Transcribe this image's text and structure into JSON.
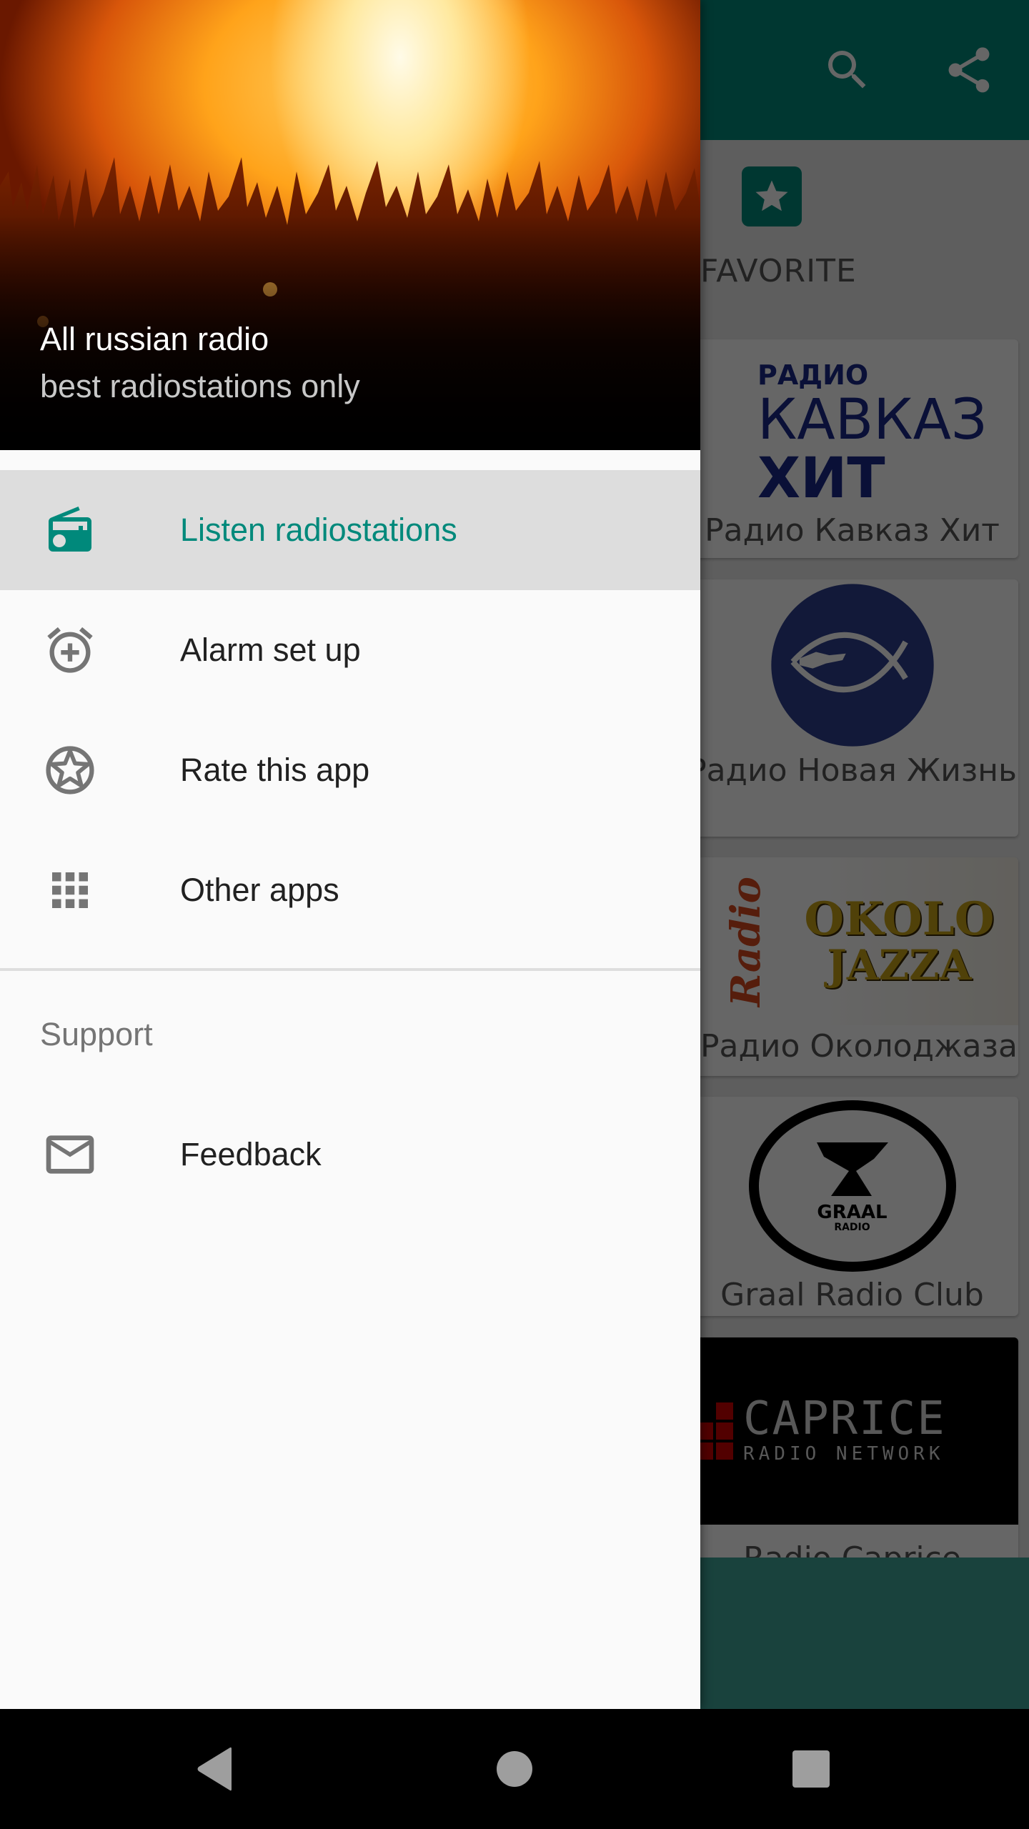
{
  "app": {
    "primary_color": "#00897B",
    "actions": [
      {
        "name": "search",
        "icon": "search-icon"
      },
      {
        "name": "share",
        "icon": "share-icon"
      }
    ],
    "tab": {
      "label": "FAVORITE",
      "icon": "star-icon"
    },
    "stations": [
      {
        "name": "Радио Кавказ Хит",
        "logo_text": [
          "РАДИО",
          "КАВКАЗ",
          "ХИТ"
        ]
      },
      {
        "name": "Радио Новая Жизнь",
        "logo_text": []
      },
      {
        "name": "Радио Околоджаза",
        "logo_text": [
          "Radio",
          "OKOLO",
          "JAZZA"
        ]
      },
      {
        "name": "Graal Radio Club",
        "logo_text": [
          "GRAAL",
          "RADIO"
        ]
      },
      {
        "name": "Radio Caprice",
        "logo_text": [
          "CAPRICE",
          "RADIO NETWORK"
        ]
      }
    ],
    "fab": {
      "icon": "star-icon"
    }
  },
  "drawer": {
    "header": {
      "title": "All russian radio",
      "subtitle": "best radiostations only"
    },
    "items": [
      {
        "label": "Listen radiostations",
        "icon": "radio-icon",
        "selected": true
      },
      {
        "label": "Alarm set up",
        "icon": "alarm-add-icon",
        "selected": false
      },
      {
        "label": "Rate this app",
        "icon": "star-circle-icon",
        "selected": false
      },
      {
        "label": "Other apps",
        "icon": "apps-grid-icon",
        "selected": false
      }
    ],
    "section": {
      "title": "Support",
      "items": [
        {
          "label": "Feedback",
          "icon": "mail-icon"
        }
      ]
    }
  },
  "navbar": {
    "buttons": [
      {
        "name": "back",
        "icon": "back-icon"
      },
      {
        "name": "home",
        "icon": "home-icon"
      },
      {
        "name": "recents",
        "icon": "recents-icon"
      }
    ]
  }
}
